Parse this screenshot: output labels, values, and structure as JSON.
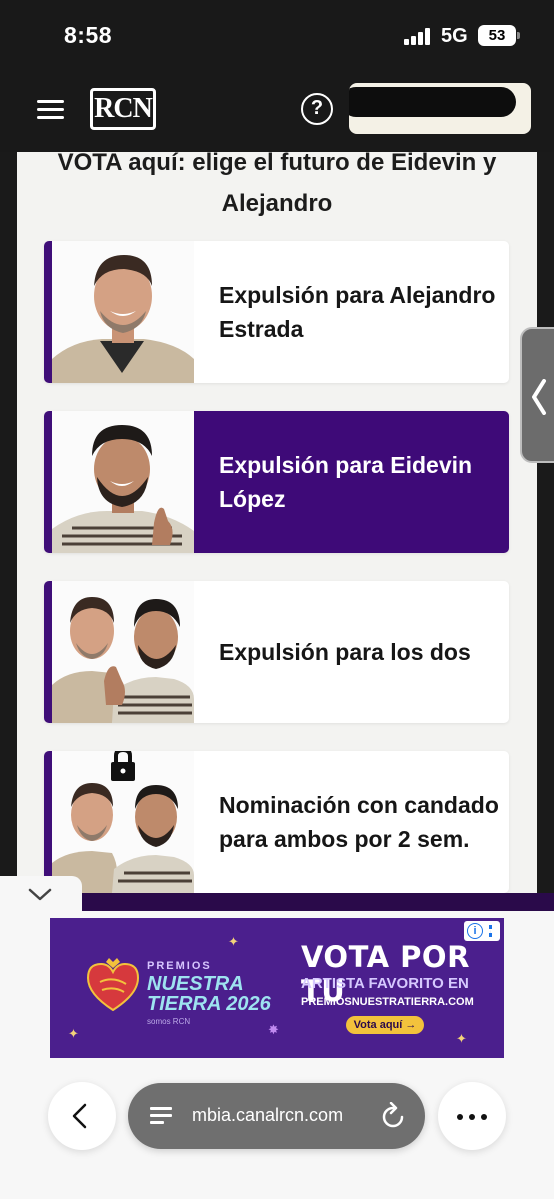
{
  "status_bar": {
    "time": "8:58",
    "network": "5G",
    "battery": "53"
  },
  "header": {
    "logo_text": "RCN",
    "help_icon": "help-circle-icon",
    "menu_icon": "hamburger-menu-icon"
  },
  "main": {
    "heading": "VOTA aquí: elige el futuro de Eidevin y Alejandro",
    "options": [
      {
        "label": "Expulsión para Alejandro Estrada",
        "selected": false
      },
      {
        "label": "Expulsión para Eidevin López",
        "selected": true
      },
      {
        "label": "Expulsión para los dos",
        "selected": false
      },
      {
        "label": "Nominación con candado para ambos por 2 sem.",
        "selected": false
      }
    ],
    "accent_color": "#3e0a78"
  },
  "ad": {
    "premios_small": "PREMIOS",
    "premios_big_1": "NUESTRA",
    "premios_big_2": "TIERRA 2026",
    "premios_sub": "somos RCN",
    "title": "VOTA POR TU",
    "line2": "ARTISTA FAVORITO EN",
    "url": "PREMIOSNUESTRATIERRA.COM",
    "cta": "Vota aquí →"
  },
  "browser": {
    "url": "mbia.canalrcn.com"
  }
}
